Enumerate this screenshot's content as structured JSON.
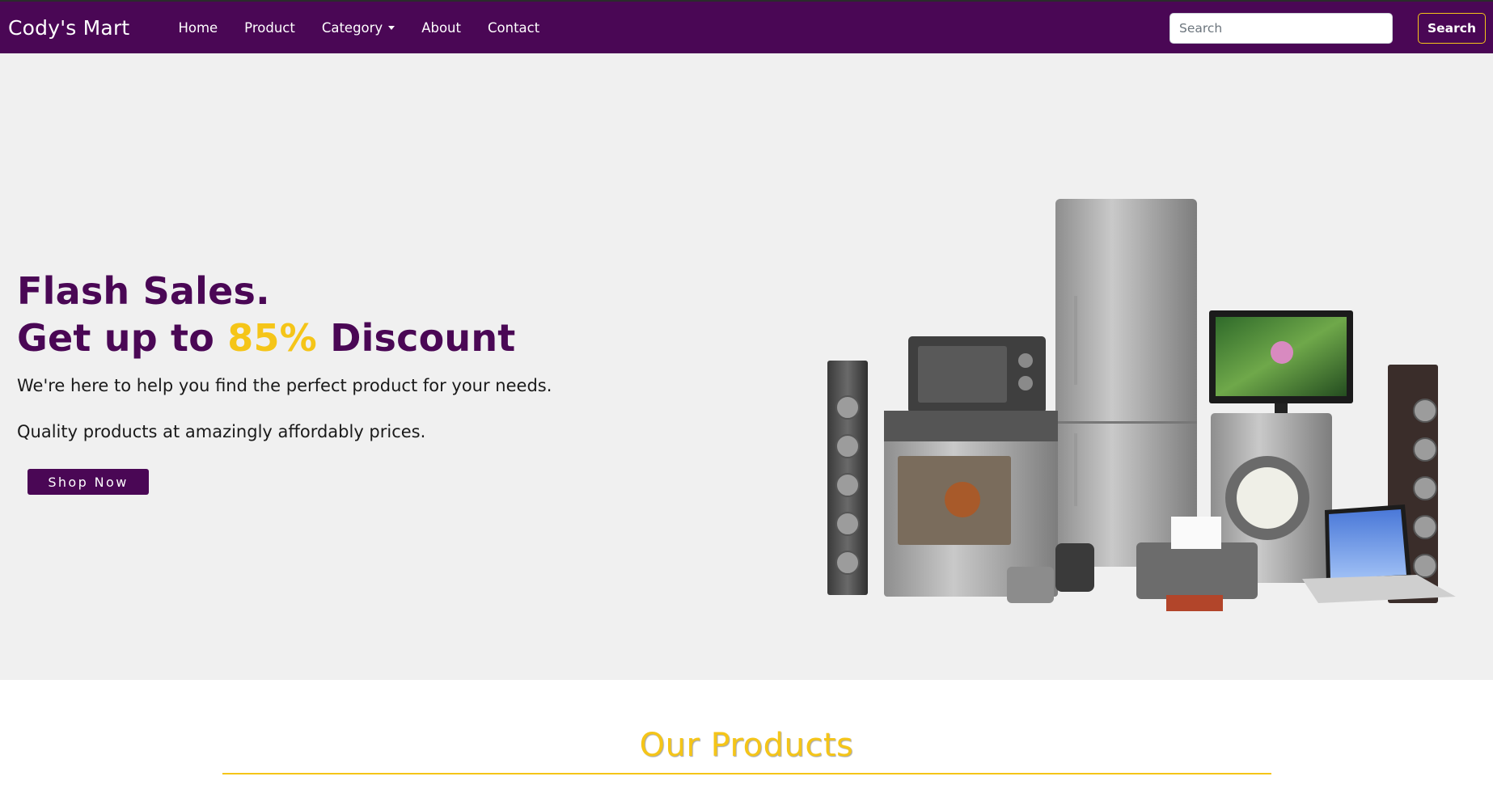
{
  "navbar": {
    "brand": "Cody's Mart",
    "links": [
      {
        "label": "Home"
      },
      {
        "label": "Product"
      },
      {
        "label": "Category"
      },
      {
        "label": "About"
      },
      {
        "label": "Contact"
      }
    ],
    "search_placeholder": "Search",
    "search_button": "Search"
  },
  "hero": {
    "title_line1": "Flash Sales.",
    "title_line2_prefix": "Get up to ",
    "title_line2_accent": "85%",
    "title_line2_suffix": " Discount",
    "line1": "We're here to help you find the perfect product for your needs.",
    "line2": "Quality products at amazingly affordably prices.",
    "cta": "Shop Now"
  },
  "products": {
    "title": "Our Products"
  },
  "colors": {
    "brand_purple": "#4a0755",
    "accent_yellow": "#f5c518",
    "hero_bg": "#f0f0f0"
  }
}
